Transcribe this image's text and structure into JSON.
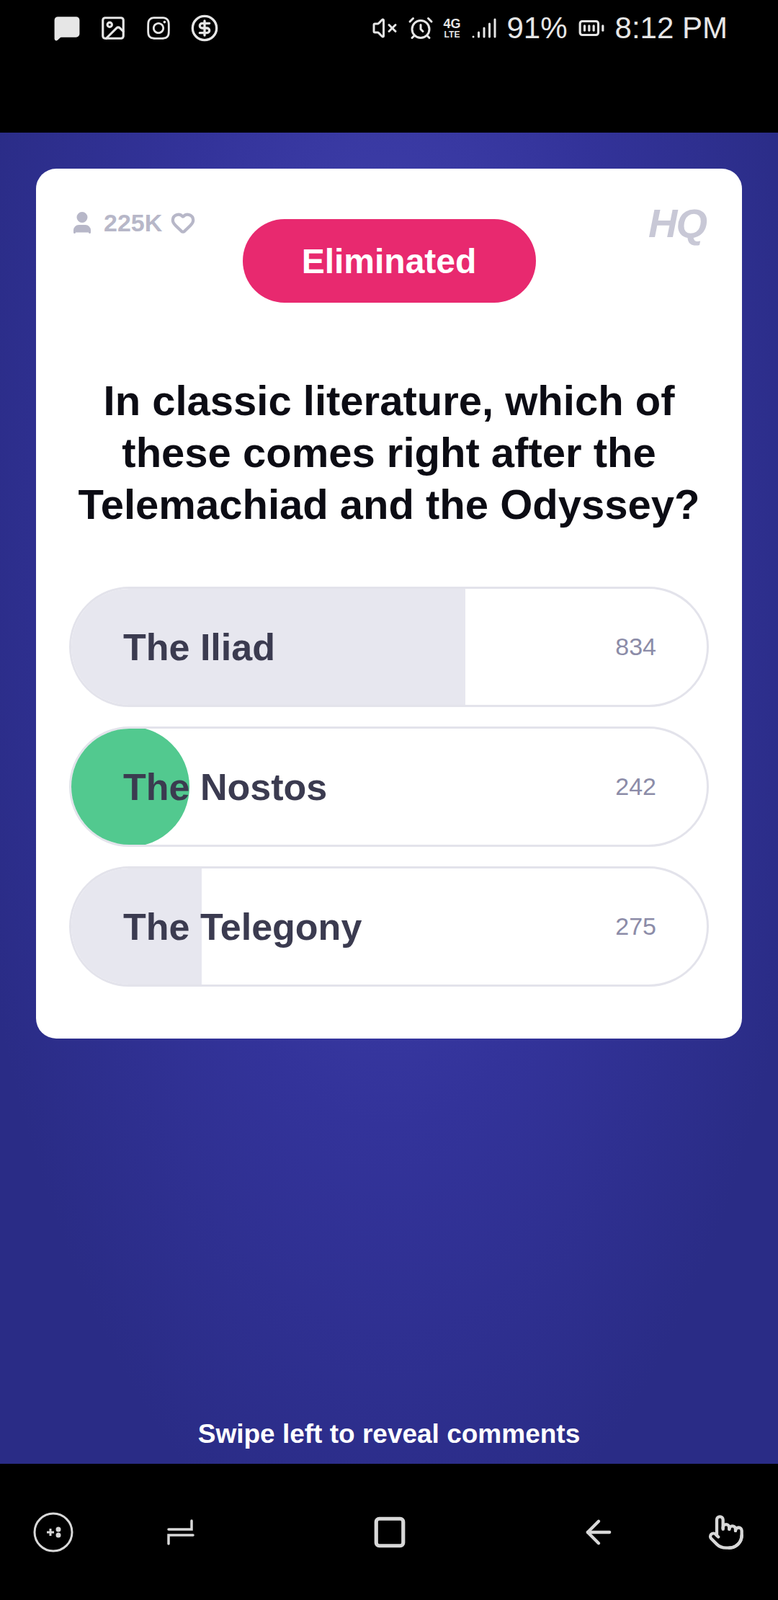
{
  "status_bar": {
    "network": "4G",
    "network_sub": "LTE",
    "battery": "91%",
    "time": "8:12 PM"
  },
  "game": {
    "players": "225K",
    "logo": "HQ",
    "status": "Eliminated"
  },
  "question": "In classic literature, which of these comes right after the Telemachiad and the Odyssey?",
  "answers": [
    {
      "label": "The Iliad",
      "count": "834",
      "level": 0.62,
      "marked": false
    },
    {
      "label": "The Nostos",
      "count": "242",
      "level": 0,
      "marked": true
    },
    {
      "label": "The Telegony",
      "count": "275",
      "level": 0.205,
      "marked": false
    }
  ],
  "footer": "Swipe left to reveal comments"
}
